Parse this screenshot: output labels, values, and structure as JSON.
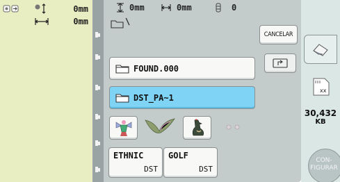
{
  "left_panel": {
    "dim_width": "0mm",
    "dim_height": "0mm"
  },
  "top_info": {
    "height_value": "0mm",
    "width_value": "0mm",
    "stitch_count": "0"
  },
  "path_text": "\\",
  "cancel_button": "CANCELAR",
  "folders": [
    {
      "name": "FOUND.000",
      "selected": false
    },
    {
      "name": "DST_PA~1",
      "selected": true
    }
  ],
  "thumbnails": [
    "angel-embroidery-icon",
    "bird-embroidery-icon",
    "rooster-embroidery-icon",
    "small-design-icon"
  ],
  "files": [
    {
      "name": "ETHNIC",
      "type": "DST"
    },
    {
      "name": "GOLF",
      "type": "DST"
    }
  ],
  "right_panel": {
    "card_label": "xx",
    "capacity_value": "30,432",
    "capacity_unit": "KB",
    "settings_line1": "CON-",
    "settings_line2": "FIGURAR"
  },
  "colors": {
    "left_bg": "#e9edc2",
    "panel_gray": "#c3cbcb",
    "selected_folder": "#7fd3f5",
    "right_bg": "#dbe7e5"
  }
}
